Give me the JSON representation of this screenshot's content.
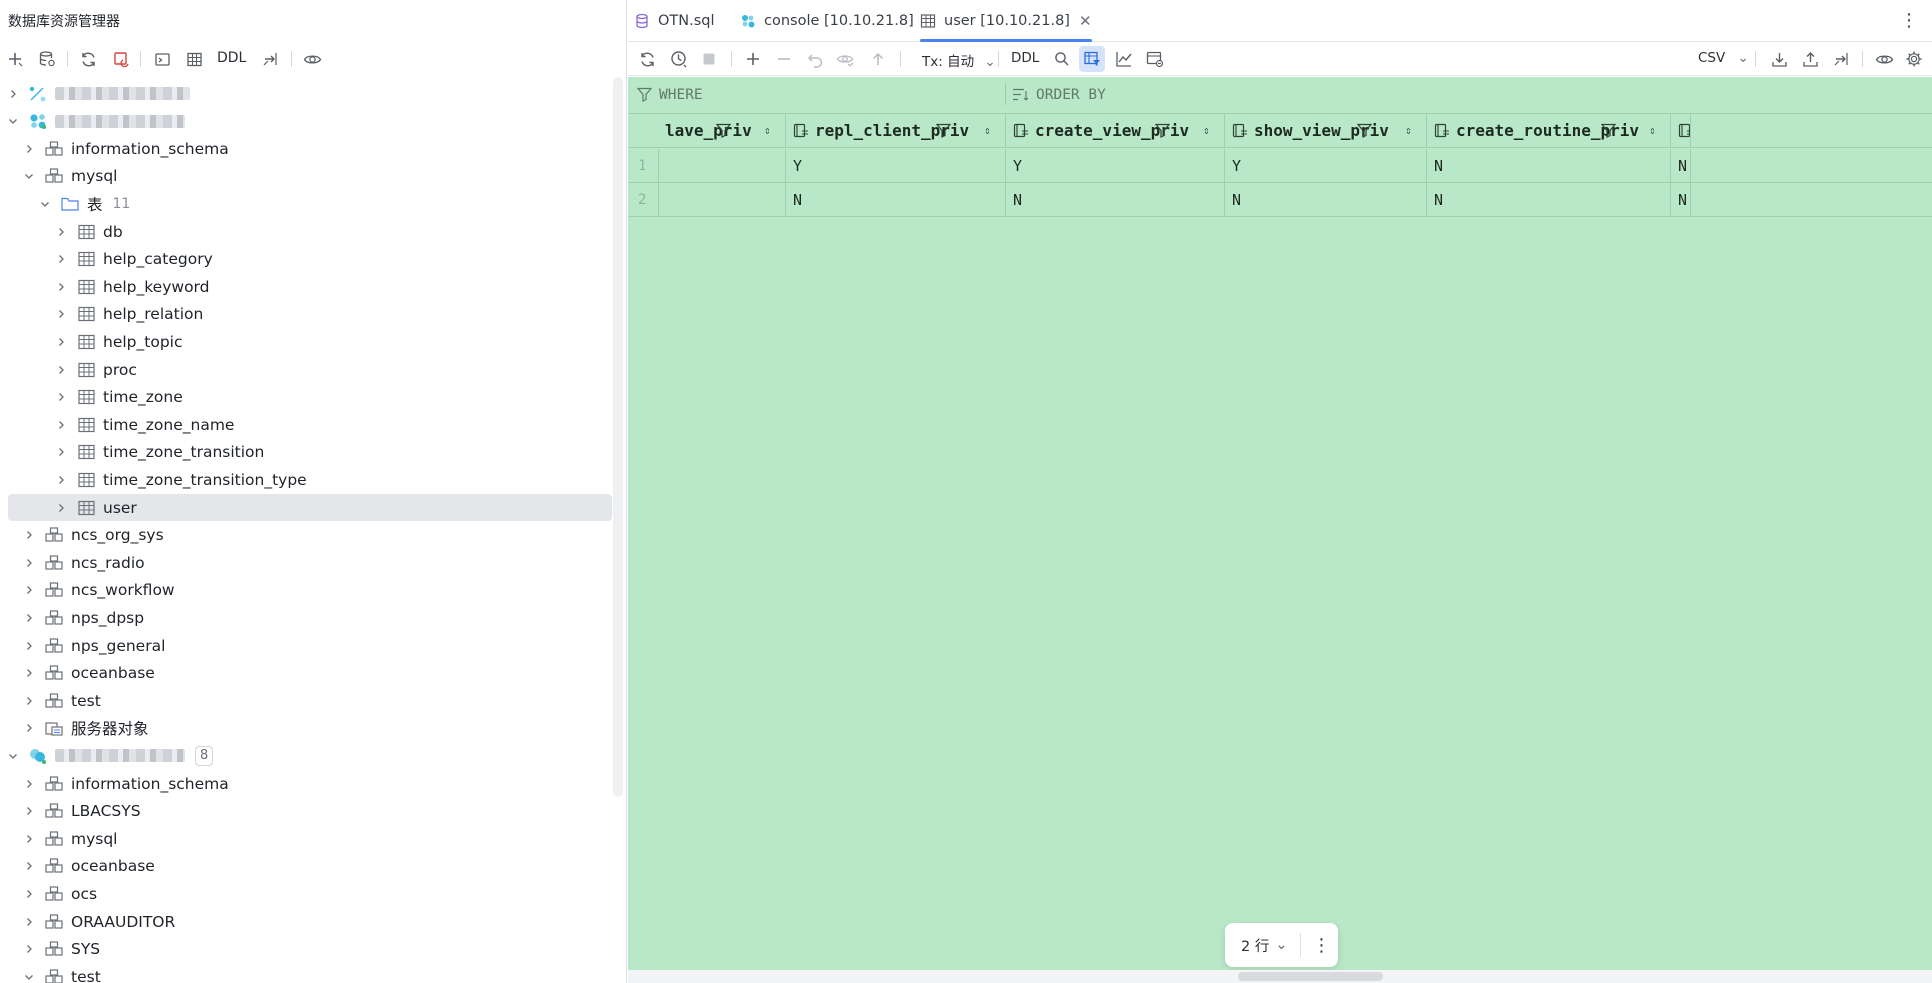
{
  "left_panel": {
    "title": "数据库资源管理器",
    "toolbar": {
      "ddl_label": "DDL"
    },
    "tree": [
      {
        "level": 0,
        "expanded": false,
        "type": "conn1",
        "label": "",
        "blurred": true,
        "blur_w": 135
      },
      {
        "level": 0,
        "expanded": true,
        "type": "conn2",
        "label": "",
        "blurred": true,
        "blur_w": 130
      },
      {
        "level": 1,
        "expanded": false,
        "type": "schema",
        "label": "information_schema"
      },
      {
        "level": 1,
        "expanded": true,
        "type": "schema",
        "label": "mysql"
      },
      {
        "level": 2,
        "expanded": true,
        "type": "folder",
        "label": "表",
        "count": "11"
      },
      {
        "level": 3,
        "expanded": false,
        "type": "table",
        "label": "db"
      },
      {
        "level": 3,
        "expanded": false,
        "type": "table",
        "label": "help_category"
      },
      {
        "level": 3,
        "expanded": false,
        "type": "table",
        "label": "help_keyword"
      },
      {
        "level": 3,
        "expanded": false,
        "type": "table",
        "label": "help_relation"
      },
      {
        "level": 3,
        "expanded": false,
        "type": "table",
        "label": "help_topic"
      },
      {
        "level": 3,
        "expanded": false,
        "type": "table",
        "label": "proc"
      },
      {
        "level": 3,
        "expanded": false,
        "type": "table",
        "label": "time_zone"
      },
      {
        "level": 3,
        "expanded": false,
        "type": "table",
        "label": "time_zone_name"
      },
      {
        "level": 3,
        "expanded": false,
        "type": "table",
        "label": "time_zone_transition"
      },
      {
        "level": 3,
        "expanded": false,
        "type": "table",
        "label": "time_zone_transition_type"
      },
      {
        "level": 3,
        "expanded": false,
        "type": "table",
        "label": "user",
        "selected": true
      },
      {
        "level": 1,
        "expanded": false,
        "type": "schema",
        "label": "ncs_org_sys"
      },
      {
        "level": 1,
        "expanded": false,
        "type": "schema",
        "label": "ncs_radio"
      },
      {
        "level": 1,
        "expanded": false,
        "type": "schema",
        "label": "ncs_workflow"
      },
      {
        "level": 1,
        "expanded": false,
        "type": "schema",
        "label": "nps_dpsp"
      },
      {
        "level": 1,
        "expanded": false,
        "type": "schema",
        "label": "nps_general"
      },
      {
        "level": 1,
        "expanded": false,
        "type": "schema",
        "label": "oceanbase"
      },
      {
        "level": 1,
        "expanded": false,
        "type": "schema",
        "label": "test"
      },
      {
        "level": 1,
        "expanded": false,
        "type": "server",
        "label": "服务器对象"
      },
      {
        "level": 0,
        "expanded": true,
        "type": "conn3",
        "label": "",
        "blurred": true,
        "blur_w": 130,
        "badge": "8"
      },
      {
        "level": 1,
        "expanded": false,
        "type": "schema",
        "label": "information_schema"
      },
      {
        "level": 1,
        "expanded": false,
        "type": "schema",
        "label": "LBACSYS"
      },
      {
        "level": 1,
        "expanded": false,
        "type": "schema",
        "label": "mysql"
      },
      {
        "level": 1,
        "expanded": false,
        "type": "schema",
        "label": "oceanbase"
      },
      {
        "level": 1,
        "expanded": false,
        "type": "schema",
        "label": "ocs"
      },
      {
        "level": 1,
        "expanded": false,
        "type": "schema",
        "label": "ORAAUDITOR"
      },
      {
        "level": 1,
        "expanded": false,
        "type": "schema",
        "label": "SYS"
      },
      {
        "level": 1,
        "expanded": true,
        "type": "schema",
        "label": "test"
      }
    ]
  },
  "tabs": [
    {
      "label": "OTN.sql",
      "icon": "database-file-icon"
    },
    {
      "label": "console [10.10.21.8]",
      "icon": "console-icon"
    },
    {
      "label": "user [10.10.21.8]",
      "icon": "table-icon",
      "active": true
    }
  ],
  "result_toolbar": {
    "tx_label": "Tx: 自动",
    "ddl_label": "DDL",
    "export_format": "CSV"
  },
  "filter": {
    "where_label": "WHERE",
    "order_by_label": "ORDER BY"
  },
  "grid": {
    "columns": [
      {
        "name": "lave_priv"
      },
      {
        "name": "repl_client_priv"
      },
      {
        "name": "create_view_priv"
      },
      {
        "name": "show_view_priv"
      },
      {
        "name": "create_routine_priv"
      },
      {
        "name": ""
      }
    ],
    "rows": [
      {
        "num": "1",
        "cells": [
          "",
          "Y",
          "Y",
          "Y",
          "N",
          "N"
        ]
      },
      {
        "num": "2",
        "cells": [
          "",
          "N",
          "N",
          "N",
          "N",
          "N"
        ]
      }
    ]
  },
  "pager": {
    "row_count_label": "2 行"
  },
  "colors": {
    "grid_bg": "#b9e8c8",
    "accent": "#4a82f0",
    "grid_line": "#9fd0b0"
  }
}
